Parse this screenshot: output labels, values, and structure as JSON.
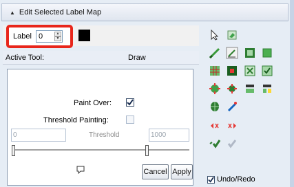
{
  "titlebar": {
    "title": "Edit Selected Label Map",
    "caret_icon": "collapse-caret-icon"
  },
  "label": {
    "text": "Label",
    "value": "0",
    "swatch_color": "#000000"
  },
  "tool": {
    "key": "Active Tool:",
    "value": "Draw"
  },
  "options": {
    "paint_over_label": "Paint Over:",
    "paint_over_checked": true,
    "threshold_painting_label": "Threshold Painting:",
    "threshold_painting_checked": false,
    "threshold_min": "0",
    "threshold_caption": "Threshold",
    "threshold_max": "1000",
    "cancel_label": "Cancel",
    "apply_label": "Apply"
  },
  "tools_grid": [
    "arrow-select-icon",
    "eraser-icon",
    "paint-brush-icon",
    "draw-pen-icon",
    "image-tool-icon",
    "green-square-icon",
    "grid-tool-1-icon",
    "grid-tool-2-icon",
    "grid-tool-3-icon",
    "grid-tool-4-icon",
    "dilate-icon",
    "erode-icon",
    "island-tool-1-icon",
    "island-tool-2-icon",
    "barrel-tool-icon",
    "wand-tool-icon",
    "prev-label-icon",
    "next-label-icon",
    "confirm-check-icon",
    "confirm-all-icon"
  ],
  "undo": {
    "label": "Undo/Redo",
    "checked": true
  },
  "colors": {
    "highlight": "#e8261b",
    "panel_bg": "#e6edf5"
  }
}
